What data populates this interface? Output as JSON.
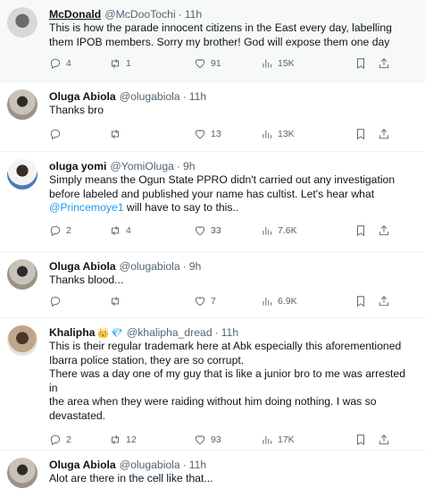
{
  "tweets": [
    {
      "name": "McDonald",
      "handle": "@McDooTochi",
      "time": "11h",
      "lines": [
        "This is how the parade innocent citizens in the East every day, labelling",
        "them IPOB members. Sorry my brother! God will expose them one day"
      ],
      "replies": "4",
      "retweets": "1",
      "likes": "91",
      "views": "15K"
    },
    {
      "name": "Oluga Abiola",
      "handle": "@olugabiola",
      "time": "11h",
      "lines": [
        "Thanks bro"
      ],
      "replies": "",
      "retweets": "",
      "likes": "13",
      "views": "13K"
    },
    {
      "name": "oluga yomi",
      "handle": "@YomiOluga",
      "time": "9h",
      "lines": [
        "Simply means the Ogun State PPRO didn't carried out any investigation",
        "before labeled and published your name has cultist. Let's hear what"
      ],
      "mention": "@Princemoye1",
      "mention_rest": " will have to say to this..",
      "replies": "2",
      "retweets": "4",
      "likes": "33",
      "views": "7.6K"
    },
    {
      "name": "Oluga Abiola",
      "handle": "@olugabiola",
      "time": "9h",
      "lines": [
        "Thanks blood..."
      ],
      "replies": "",
      "retweets": "",
      "likes": "7",
      "views": "6.9K"
    },
    {
      "name": "Khalipha",
      "emojis": [
        "👑",
        "💎"
      ],
      "handle": "@khalipha_dread",
      "time": "11h",
      "lines": [
        "This is their regular trademark here at Abk especially this aforementioned",
        "Ibarra police station, they are so corrupt.",
        "There was a day one of my guy that is like a junior bro to me was arrested in",
        "the area when they were raiding without him doing nothing. I was so",
        "devastated."
      ],
      "replies": "2",
      "retweets": "12",
      "likes": "93",
      "views": "17K"
    },
    {
      "name": "Oluga Abiola",
      "handle": "@olugabiola",
      "time": "11h",
      "lines": [
        "Alot are there in the cell like that..."
      ]
    }
  ],
  "separator": "·",
  "icons": {
    "reply": "reply-icon",
    "retweet": "retweet-icon",
    "like": "heart-icon",
    "views": "views-chart-icon",
    "bookmark": "bookmark-icon",
    "share": "share-icon",
    "more": "more-dots-icon"
  },
  "colors": {
    "text": "#0f1419",
    "secondary": "#536471",
    "link": "#1d9bf0",
    "highlight_bg": "#f7f9f9"
  }
}
